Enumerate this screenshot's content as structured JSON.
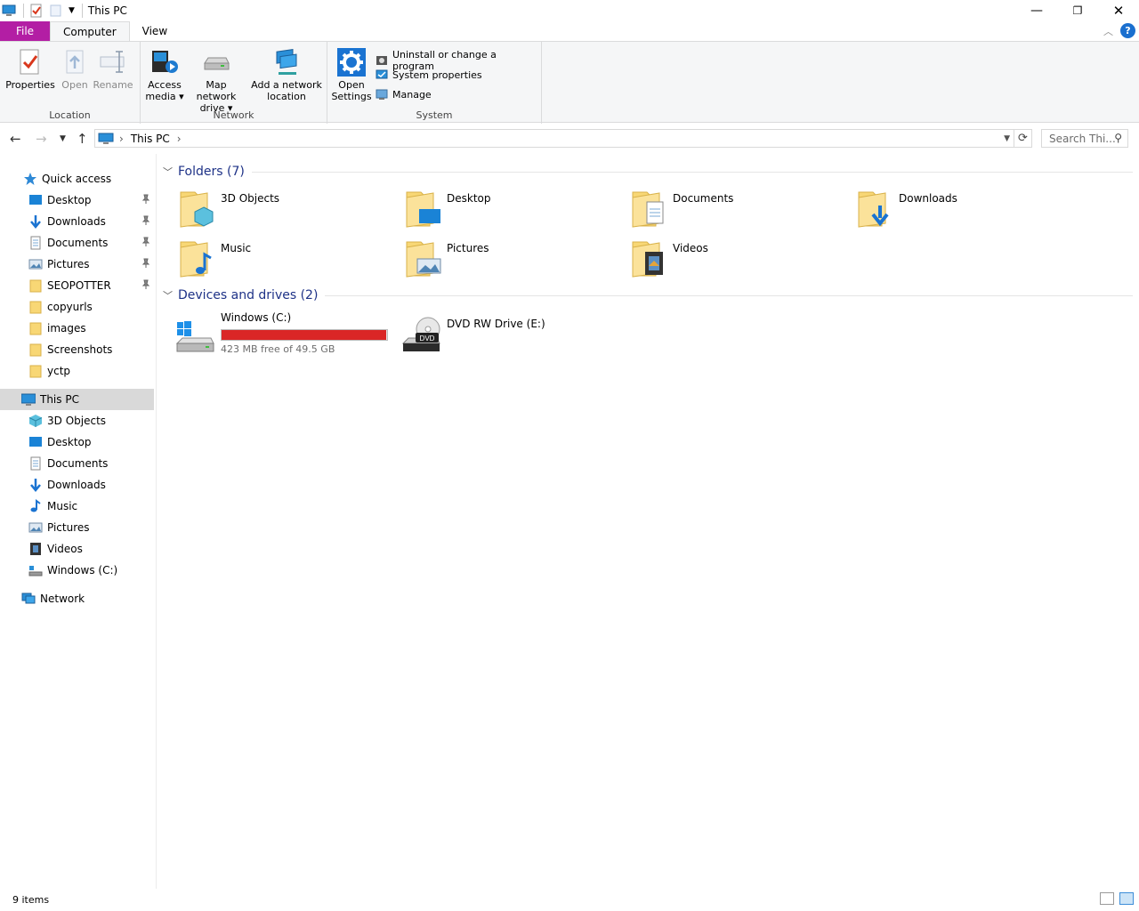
{
  "window": {
    "title": "This PC",
    "controls": [
      "—",
      "❐",
      "✕"
    ]
  },
  "ribbon": {
    "tabs": [
      {
        "label": "File"
      },
      {
        "label": "Computer"
      },
      {
        "label": "View"
      }
    ],
    "help_label": "?",
    "location": {
      "label": "Location",
      "properties": "Properties",
      "open": "Open",
      "rename": "Rename"
    },
    "network": {
      "label": "Network",
      "access_media_1": "Access",
      "access_media_2": "media ▾",
      "map_drive_1": "Map network",
      "map_drive_2": "drive ▾",
      "add_location_1": "Add a network",
      "add_location_2": "location"
    },
    "system": {
      "label": "System",
      "open_settings_1": "Open",
      "open_settings_2": "Settings",
      "uninstall": "Uninstall or change a program",
      "system_properties": "System properties",
      "manage": "Manage"
    }
  },
  "address_bar": {
    "path": "This PC",
    "search_placeholder": "Search Thi..."
  },
  "nav_pane": {
    "quick_access": "Quick access",
    "quick_items": [
      {
        "label": "Desktop",
        "pinned": true
      },
      {
        "label": "Downloads",
        "pinned": true
      },
      {
        "label": "Documents",
        "pinned": true
      },
      {
        "label": "Pictures",
        "pinned": true
      },
      {
        "label": "SEOPOTTER",
        "pinned": true
      },
      {
        "label": "copyurls",
        "pinned": false
      },
      {
        "label": "images",
        "pinned": false
      },
      {
        "label": "Screenshots",
        "pinned": false
      },
      {
        "label": "yctp",
        "pinned": false
      }
    ],
    "this_pc": "This PC",
    "pc_items": [
      {
        "label": "3D Objects"
      },
      {
        "label": "Desktop"
      },
      {
        "label": "Documents"
      },
      {
        "label": "Downloads"
      },
      {
        "label": "Music"
      },
      {
        "label": "Pictures"
      },
      {
        "label": "Videos"
      },
      {
        "label": "Windows (C:)"
      }
    ],
    "network": "Network"
  },
  "content": {
    "folders_header": "Folders (7)",
    "folders": [
      {
        "label": "3D Objects",
        "icon": "3d-objects-folder-icon"
      },
      {
        "label": "Desktop",
        "icon": "desktop-folder-icon"
      },
      {
        "label": "Documents",
        "icon": "documents-folder-icon"
      },
      {
        "label": "Downloads",
        "icon": "downloads-folder-icon"
      },
      {
        "label": "Music",
        "icon": "music-folder-icon"
      },
      {
        "label": "Pictures",
        "icon": "pictures-folder-icon"
      },
      {
        "label": "Videos",
        "icon": "videos-folder-icon"
      }
    ],
    "devices_header": "Devices and drives (2)",
    "drives": [
      {
        "label": "Windows (C:)",
        "free_text": "423 MB free of 49.5 GB",
        "used_fraction": 0.992
      },
      {
        "label": "DVD RW Drive (E:)"
      }
    ]
  },
  "status": {
    "count": "9 items"
  },
  "colors": {
    "file_tab": "#b31ea4",
    "section_header": "#1e3287",
    "drive_full": "#da2626",
    "folder_yellow": "#f8d775"
  }
}
